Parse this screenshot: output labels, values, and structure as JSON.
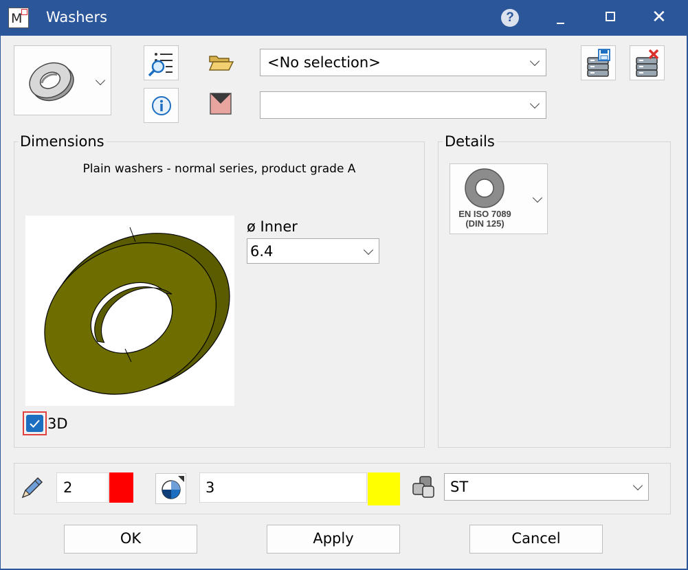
{
  "window": {
    "title": "Washers",
    "help_icon": "?",
    "colors": {
      "titlebar": "#2b579a",
      "body": "#f0f0f0",
      "accent": "#1c6ec0"
    }
  },
  "toolbar": {
    "selection_combo": {
      "value": "<No selection>"
    },
    "second_combo": {
      "value": ""
    },
    "icons": [
      "washer-type-icon",
      "search-list-icon",
      "info-icon",
      "folder-open-icon",
      "envelope-icon",
      "database-save-icon",
      "database-delete-icon"
    ]
  },
  "dimensions": {
    "label": "Dimensions",
    "subtitle": "Plain washers - normal series, product grade A",
    "inner_label": "ø Inner",
    "inner_value": "6.4",
    "checkbox_3d": {
      "label": "3D",
      "checked": true
    },
    "washer_color": "#6e6e00"
  },
  "details": {
    "label": "Details",
    "standard_line1": "EN ISO 7089",
    "standard_line2": "(DIN 125)"
  },
  "bottom": {
    "pen_width": "2",
    "pen_color": "#ff0000",
    "layer_value": "3",
    "layer_color": "#ffff00",
    "material_value": "ST"
  },
  "buttons": {
    "ok": "OK",
    "apply": "Apply",
    "cancel": "Cancel"
  }
}
